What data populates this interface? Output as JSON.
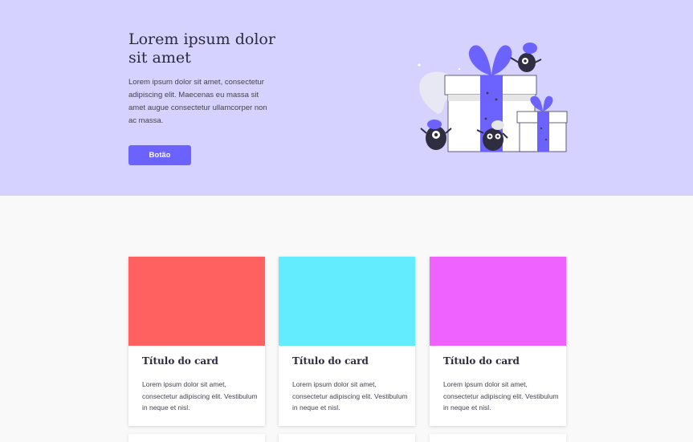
{
  "hero": {
    "title": "Lorem ipsum dolor sit amet",
    "text": "Lorem ipsum dolor sit amet, consectetur adipiscing elit. Maecenas eu massa sit amet augue consectetur ullamcorper non ac massa.",
    "button_label": "Botão",
    "background_color": "#d5d2ff",
    "accent_color": "#6c63ff"
  },
  "illustration": {
    "icon": "gift-boxes-monsters-illustration"
  },
  "cards": [
    {
      "image_color": "#ff6161",
      "title": "Título do card",
      "text": "Lorem ipsum dolor sit amet, consectetur adipiscing elit. Vestibulum in neque et nisl."
    },
    {
      "image_color": "#63ecfd",
      "title": "Título do card",
      "text": "Lorem ipsum dolor sit amet, consectetur adipiscing elit. Vestibulum in neque et nisl."
    },
    {
      "image_color": "#f062ff",
      "title": "Título do card",
      "text": "Lorem ipsum dolor sit amet, consectetur adipiscing elit. Vestibulum in neque et nisl."
    }
  ]
}
